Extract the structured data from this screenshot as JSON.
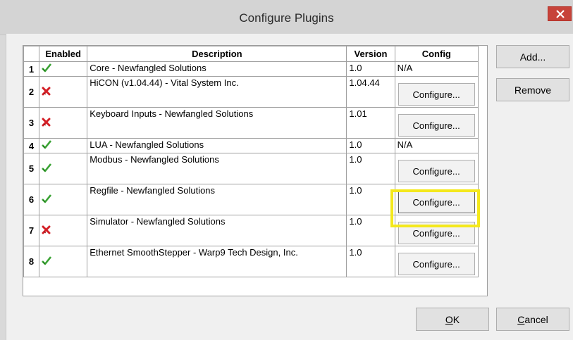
{
  "window": {
    "title": "Configure Plugins"
  },
  "columns": {
    "num": "",
    "enabled": "Enabled",
    "description": "Description",
    "version": "Version",
    "config": "Config"
  },
  "rows": [
    {
      "num": "1",
      "enabled": true,
      "description": "Core - Newfangled Solutions",
      "version": "1.0",
      "config": "N/A"
    },
    {
      "num": "2",
      "enabled": false,
      "description": "HiCON (v1.04.44) - Vital System Inc.",
      "version": "1.04.44",
      "config": "Configure..."
    },
    {
      "num": "3",
      "enabled": false,
      "description": "Keyboard Inputs - Newfangled Solutions",
      "version": "1.01",
      "config": "Configure..."
    },
    {
      "num": "4",
      "enabled": true,
      "description": "LUA - Newfangled Solutions",
      "version": "1.0",
      "config": "N/A"
    },
    {
      "num": "5",
      "enabled": true,
      "description": "Modbus - Newfangled Solutions",
      "version": "1.0",
      "config": "Configure..."
    },
    {
      "num": "6",
      "enabled": true,
      "description": "Regfile - Newfangled Solutions",
      "version": "1.0",
      "config": "Configure..."
    },
    {
      "num": "7",
      "enabled": false,
      "description": "Simulator - Newfangled Solutions",
      "version": "1.0",
      "config": "Configure..."
    },
    {
      "num": "8",
      "enabled": true,
      "description": "Ethernet SmoothStepper - Warp9 Tech Design, Inc.",
      "version": "1.0",
      "config": "Configure..."
    }
  ],
  "buttons": {
    "add": "Add...",
    "remove": "Remove",
    "ok_mnemonic": "O",
    "ok_rest": "K",
    "cancel_mnemonic": "C",
    "cancel_rest": "ancel"
  },
  "icons": {
    "enabled": "check-icon",
    "disabled": "cross-icon",
    "close": "close-icon"
  },
  "colors": {
    "check": "#3aa334",
    "cross": "#d41f26",
    "close_bg": "#c7433a",
    "highlight": "#f4e81c"
  }
}
